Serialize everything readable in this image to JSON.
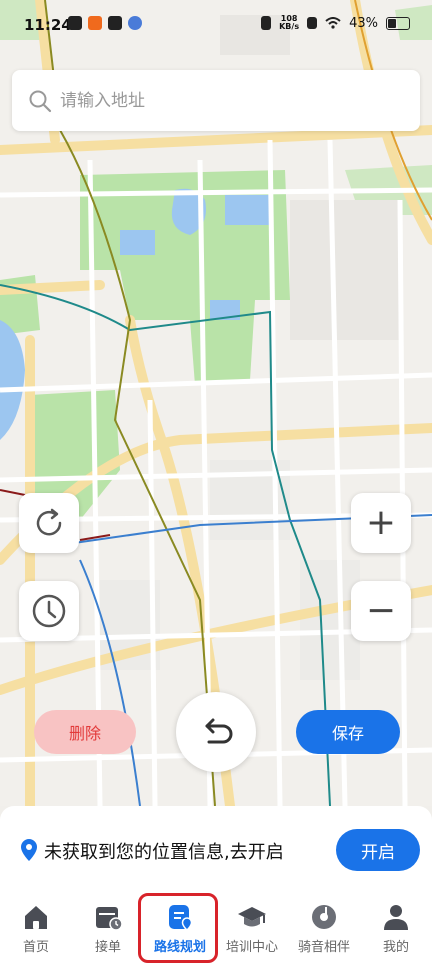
{
  "status_bar": {
    "time": "11:24",
    "net_speed_value": "108",
    "net_speed_unit": "KB/s",
    "battery": "43%"
  },
  "search": {
    "placeholder": "请输入地址"
  },
  "map_controls": {
    "refresh_icon": "refresh-icon",
    "history_icon": "clock-icon",
    "zoom_in": "+",
    "zoom_out": "−"
  },
  "actions": {
    "delete_label": "删除",
    "save_label": "保存",
    "undo_icon": "undo-icon"
  },
  "location_prompt": {
    "text": "未获取到您的位置信息,去开启",
    "button_label": "开启"
  },
  "tabs": [
    {
      "label": "首页",
      "icon": "home-icon"
    },
    {
      "label": "接单",
      "icon": "calendar-icon"
    },
    {
      "label": "路线规划",
      "icon": "route-icon",
      "active": true
    },
    {
      "label": "培训中心",
      "icon": "graduation-cap-icon"
    },
    {
      "label": "骑音相伴",
      "icon": "music-disc-icon"
    },
    {
      "label": "我的",
      "icon": "user-icon"
    }
  ],
  "colors": {
    "accent": "#1a73e8",
    "delete_bg": "#f8c3c3",
    "delete_text": "#e23a3a",
    "highlight_border": "#d8232a"
  }
}
